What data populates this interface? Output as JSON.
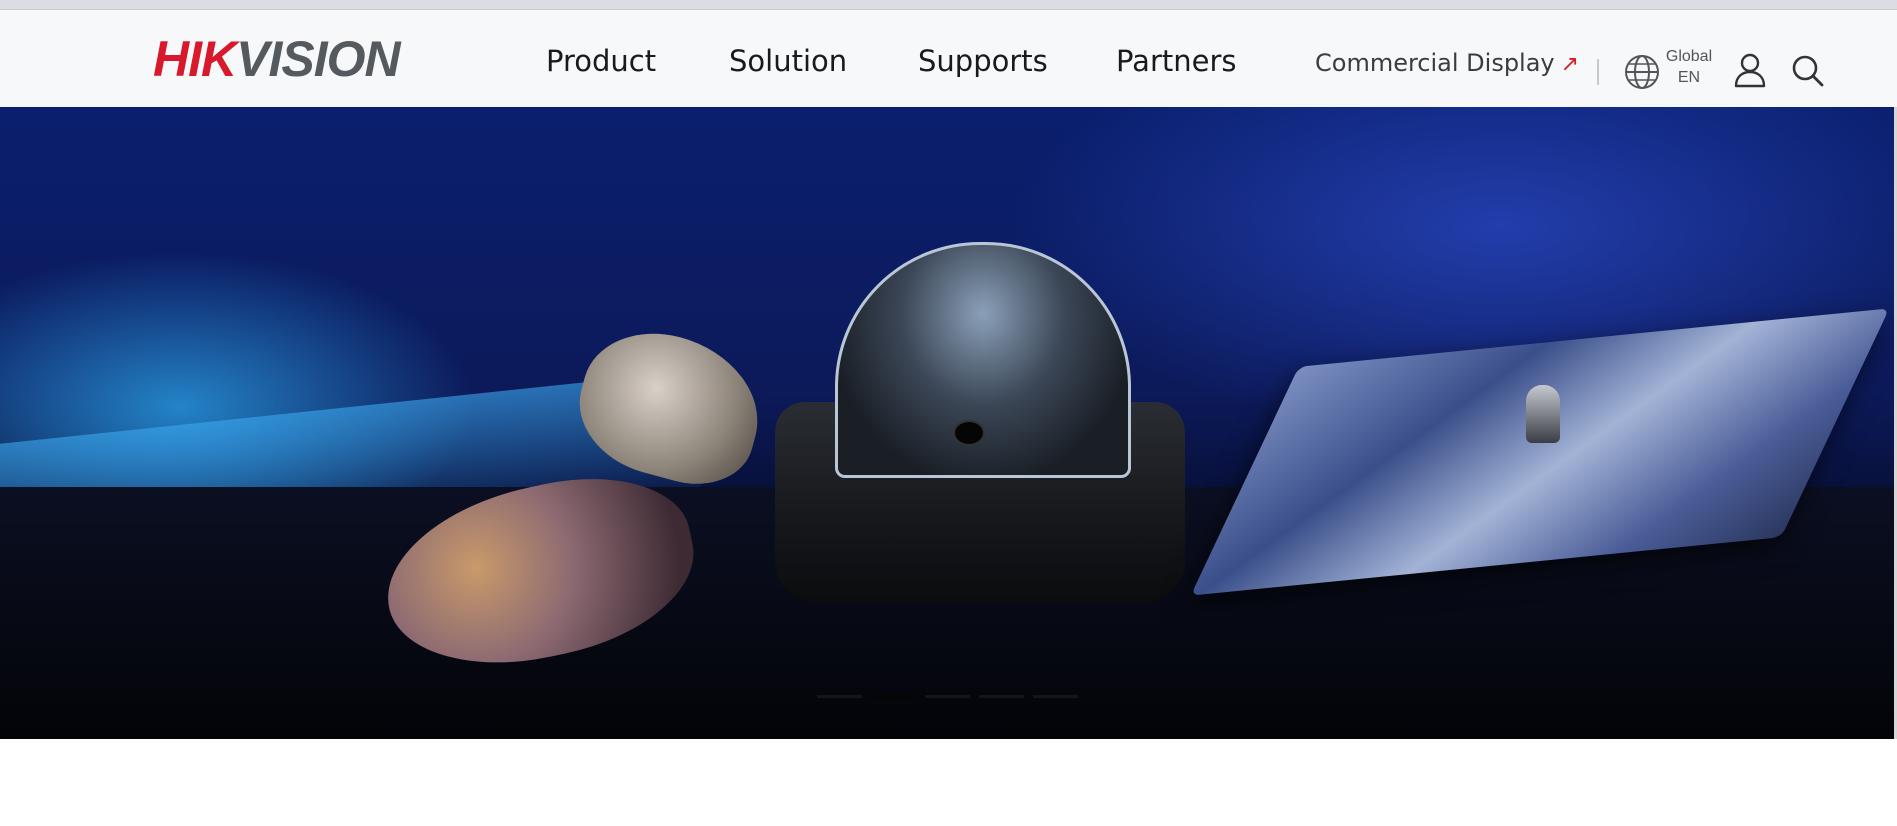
{
  "header": {
    "logo": {
      "part1": "HIK",
      "part2": "VISION"
    },
    "nav": [
      {
        "label": "Product"
      },
      {
        "label": "Solution"
      },
      {
        "label": "Supports"
      },
      {
        "label": "Partners"
      }
    ],
    "commercial_display": {
      "label": "Commercial Display",
      "icon": "external-arrow-icon"
    },
    "language": {
      "region": "Global",
      "code": "EN",
      "icon": "globe-icon"
    },
    "icons": {
      "user": "user-icon",
      "search": "search-icon"
    }
  },
  "hero": {
    "carousel": {
      "slide_count": 5,
      "active_index": 1
    }
  },
  "colors": {
    "brand_red": "#d7192b",
    "header_bg": "#f7f8fa"
  }
}
